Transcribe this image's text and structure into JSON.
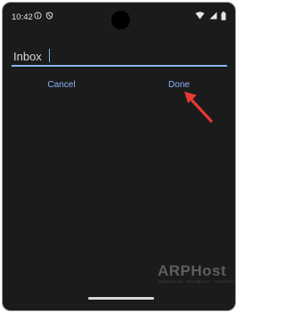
{
  "status_bar": {
    "time": "10:42",
    "left_icons": [
      "info-icon",
      "shield-icon"
    ],
    "right_icons": [
      "wifi-icon",
      "signal-icon",
      "battery-icon"
    ]
  },
  "edit_field": {
    "value": "Inbox"
  },
  "actions": {
    "cancel_label": "Cancel",
    "done_label": "Done"
  },
  "annotation": {
    "arrow_color": "#e53935",
    "icon": "arrow-pointer-icon"
  },
  "watermark": {
    "brand": "ARPHost",
    "tagline": "INNOVATION · RELIABILITY · SECURITY"
  },
  "colors": {
    "accent": "#8ab4f8",
    "background": "#1b1b1b"
  }
}
